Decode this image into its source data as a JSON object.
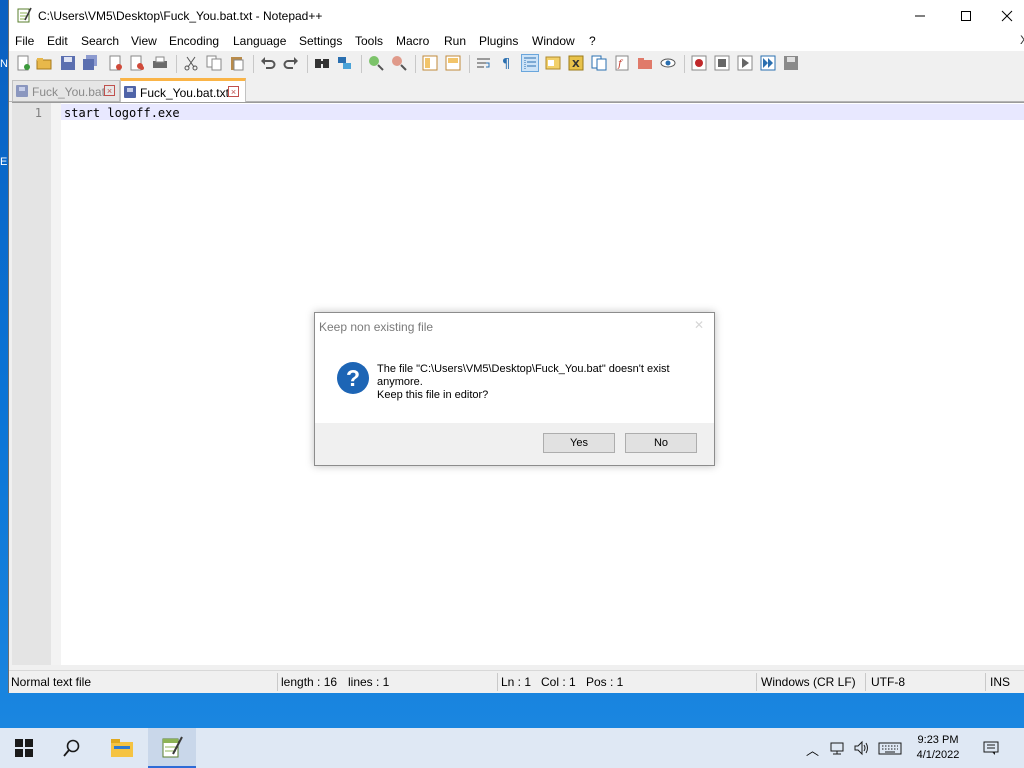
{
  "window": {
    "title": "C:\\Users\\VM5\\Desktop\\Fuck_You.bat.txt - Notepad++",
    "minimize_icon": "minimize-icon",
    "maximize_icon": "maximize-icon",
    "close_icon": "close-icon"
  },
  "desktop": {
    "edge_glyphs": [
      "N",
      "E"
    ]
  },
  "menu": {
    "items": [
      "File",
      "Edit",
      "Search",
      "View",
      "Encoding",
      "Language",
      "Settings",
      "Tools",
      "Macro",
      "Run",
      "Plugins",
      "Window",
      "?"
    ],
    "close_glyph": "X"
  },
  "toolbar": {
    "icons": [
      "new-file-icon",
      "open-file-icon",
      "save-icon",
      "save-all-icon",
      "close-icon",
      "close-all-icon",
      "print-icon",
      "cut-icon",
      "copy-icon",
      "paste-icon",
      "undo-icon",
      "redo-icon",
      "find-icon",
      "replace-icon",
      "zoom-in-icon",
      "zoom-out-icon",
      "sync-vertical-icon",
      "sync-horizontal-icon",
      "word-wrap-icon",
      "show-all-characters-icon",
      "indent-guide-icon",
      "user-defined-language-icon",
      "document-map-icon",
      "document-list-icon",
      "function-list-icon",
      "folder-as-workspace-icon",
      "monitoring-icon",
      "macro-record-icon",
      "macro-stop-icon",
      "macro-play-icon",
      "macro-run-multiple-icon",
      "macro-save-icon"
    ]
  },
  "tabs": [
    {
      "label": "Fuck_You.bat",
      "active": false
    },
    {
      "label": "Fuck_You.bat.txt",
      "active": true
    }
  ],
  "tab_close_glyph": "×",
  "editor": {
    "line_numbers": [
      "1"
    ],
    "lines": [
      "start logoff.exe"
    ]
  },
  "statusbar": {
    "file_type": "Normal text file",
    "length": "length : 16",
    "lines": "lines : 1",
    "ln": "Ln : 1",
    "col": "Col : 1",
    "pos": "Pos : 1",
    "eol": "Windows (CR LF)",
    "encoding": "UTF-8",
    "mode": "INS"
  },
  "dialog": {
    "title": "Keep non existing file",
    "icon": "question-icon",
    "icon_glyph": "?",
    "message_line1": "The file \"C:\\Users\\VM5\\Desktop\\Fuck_You.bat\" doesn't exist anymore.",
    "message_line2": "Keep this file in editor?",
    "yes_label": "Yes",
    "no_label": "No"
  },
  "taskbar": {
    "icons": [
      "windows-start-icon",
      "search-icon",
      "file-explorer-icon",
      "notepadpp-icon"
    ],
    "tray_icons": [
      "chevron-up-icon",
      "network-icon",
      "volume-icon",
      "keyboard-icon"
    ],
    "time": "9:23 PM",
    "date": "4/1/2022",
    "notifications_icon": "notifications-icon"
  },
  "colors": {
    "tab_active_accent": "#fab447",
    "dialog_icon": "#1d65b5",
    "current_line": "#e8e8ff",
    "desktop": "#0b74d6"
  }
}
